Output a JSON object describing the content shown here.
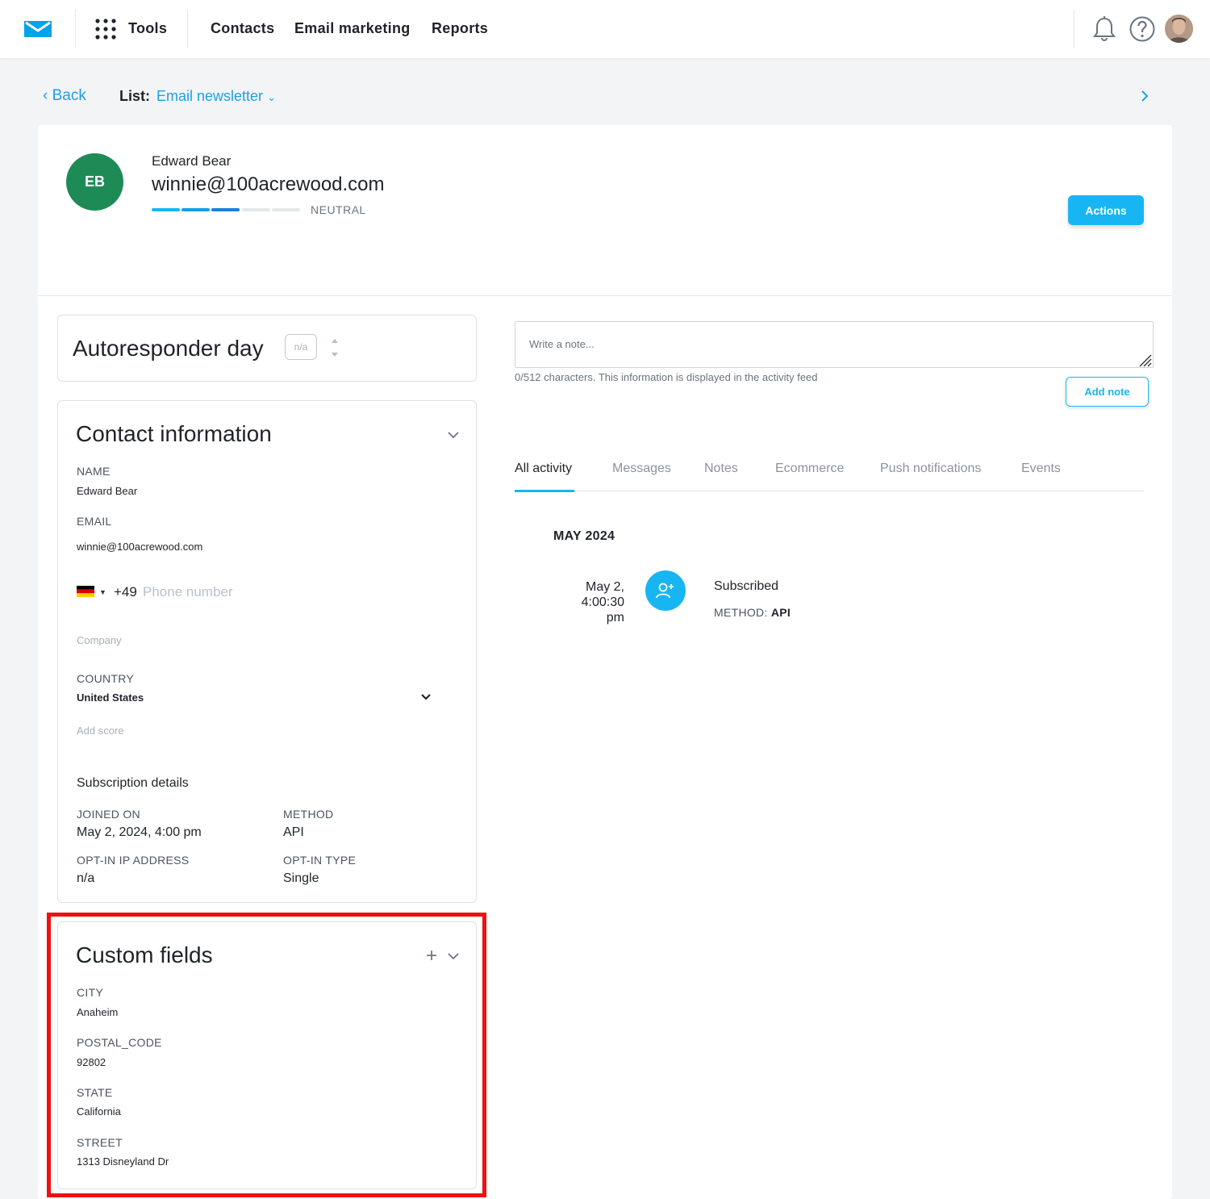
{
  "nav": {
    "tools_label": "Tools",
    "items": [
      "Contacts",
      "Email marketing",
      "Reports"
    ],
    "icons": [
      "bell-icon",
      "help-icon",
      "user-avatar"
    ]
  },
  "breadcrumb": {
    "back_label": "Back",
    "list_label": "List:",
    "list_value": "Email newsletter"
  },
  "contact": {
    "initials": "EB",
    "name": "Edward Bear",
    "email": "winnie@100acrewood.com",
    "engagement_label": "NEUTRAL",
    "engagement_level": 3,
    "engagement_max": 5,
    "actions_label": "Actions",
    "avatar_color": "#1e8b57"
  },
  "autoresponder": {
    "title": "Autoresponder day",
    "value": "n/a"
  },
  "contact_info": {
    "title": "Contact information",
    "name_label": "NAME",
    "name_value": "Edward Bear",
    "email_label": "EMAIL",
    "email_value": "winnie@100acrewood.com",
    "phone_code": "+49",
    "phone_placeholder": "Phone number",
    "company_placeholder": "Company",
    "country_label": "COUNTRY",
    "country_value": "United States",
    "score_placeholder": "Add score",
    "subscription_title": "Subscription details",
    "joined_label": "JOINED ON",
    "joined_value": "May 2, 2024, 4:00 pm",
    "method_label": "METHOD",
    "method_value": "API",
    "ip_label": "OPT-IN IP ADDRESS",
    "ip_value": "n/a",
    "optin_type_label": "OPT-IN TYPE",
    "optin_type_value": "Single"
  },
  "custom_fields": {
    "title": "Custom fields",
    "fields": [
      {
        "label": "CITY",
        "value": "Anaheim"
      },
      {
        "label": "POSTAL_CODE",
        "value": "92802"
      },
      {
        "label": "STATE",
        "value": "California"
      },
      {
        "label": "STREET",
        "value": "1313 Disneyland Dr"
      }
    ]
  },
  "notes": {
    "placeholder": "Write a note...",
    "help": "0/512 characters. This information is displayed in the activity feed",
    "add_label": "Add note"
  },
  "activity": {
    "tabs": [
      "All activity",
      "Messages",
      "Notes",
      "Ecommerce",
      "Push notifications",
      "Events"
    ],
    "active_tab": 0,
    "month": "MAY 2024",
    "items": [
      {
        "date": "May 2, 4:00:30 pm",
        "title": "Subscribed",
        "meta_label": "METHOD:",
        "meta_value": "API"
      }
    ]
  },
  "colors": {
    "accent": "#17b6f2",
    "link": "#1aa1e8",
    "highlight": "#ee1111"
  }
}
